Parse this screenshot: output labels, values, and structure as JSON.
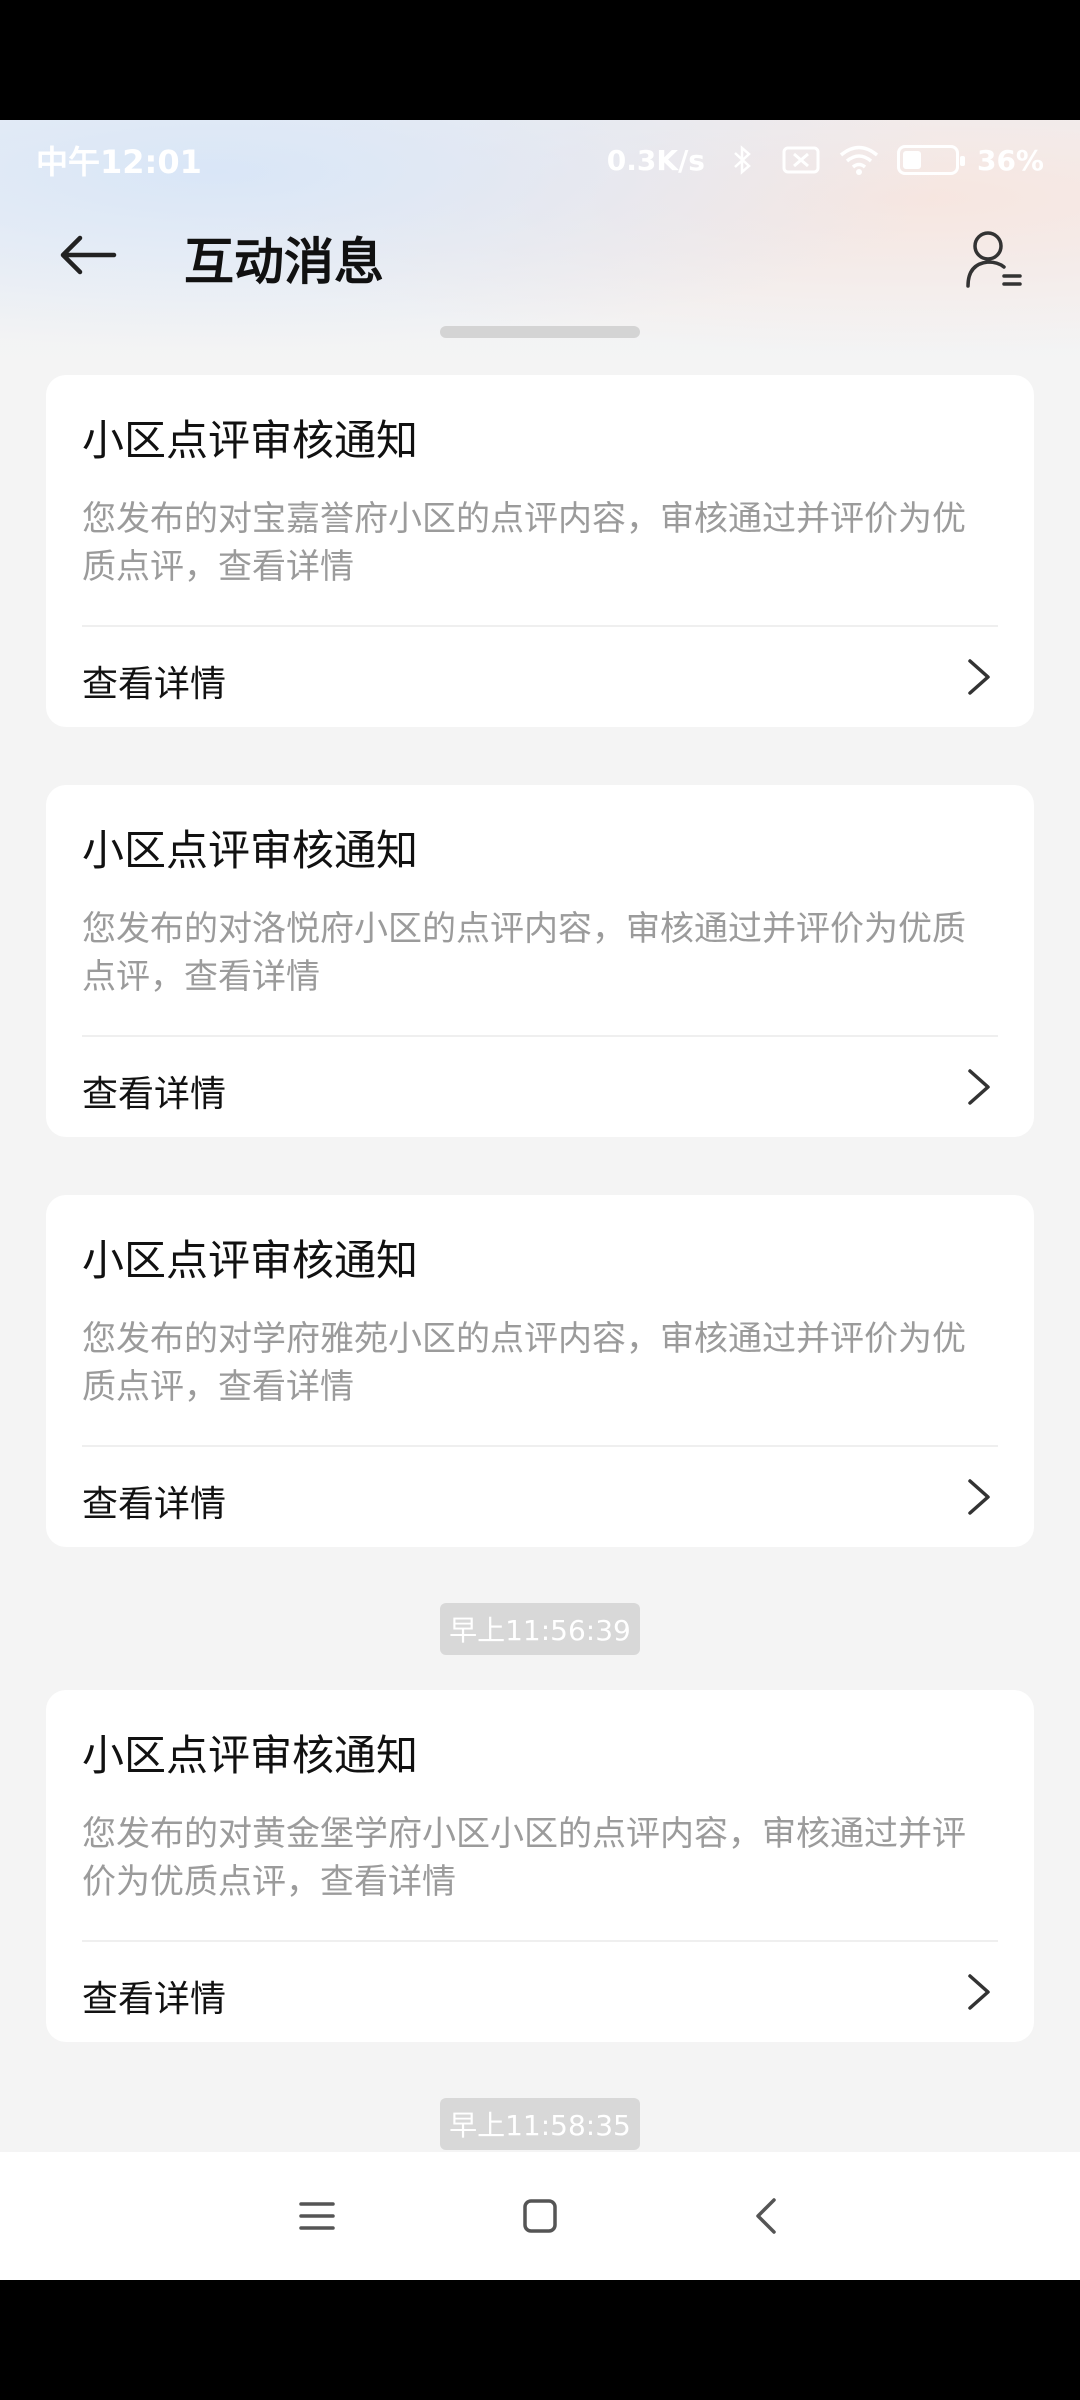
{
  "status_bar": {
    "time": "中午12:01",
    "network_speed": "0.3K/s",
    "battery_percent": "36%",
    "battery_level": 0.36
  },
  "header": {
    "title": "互动消息"
  },
  "cards": [
    {
      "title": "小区点评审核通知",
      "body": "您发布的对宝嘉誉府小区的点评内容，审核通过并评价为优质点评，查看详情",
      "action": "查看详情"
    },
    {
      "title": "小区点评审核通知",
      "body": "您发布的对洛悦府小区的点评内容，审核通过并评价为优质点评，查看详情",
      "action": "查看详情"
    },
    {
      "title": "小区点评审核通知",
      "body": "您发布的对学府雅苑小区的点评内容，审核通过并评价为优质点评，查看详情",
      "action": "查看详情"
    },
    {
      "title": "小区点评审核通知",
      "body": "您发布的对黄金堡学府小区小区的点评内容，审核通过并评价为优质点评，查看详情",
      "action": "查看详情"
    }
  ],
  "timestamps": [
    "早上11:56:39",
    "早上11:58:35"
  ],
  "icons": {
    "back": "arrow-left-icon",
    "profile": "user-list-icon",
    "chevron": "chevron-right-icon",
    "nav_menu": "menu-icon",
    "nav_home": "home-square-icon",
    "nav_back": "back-chevron-icon"
  },
  "colors": {
    "background": "#f4f4f4",
    "card": "#ffffff",
    "title_text": "#111111",
    "body_text": "#9b9b9b",
    "timestamp_bg": "#d8d8d8"
  }
}
